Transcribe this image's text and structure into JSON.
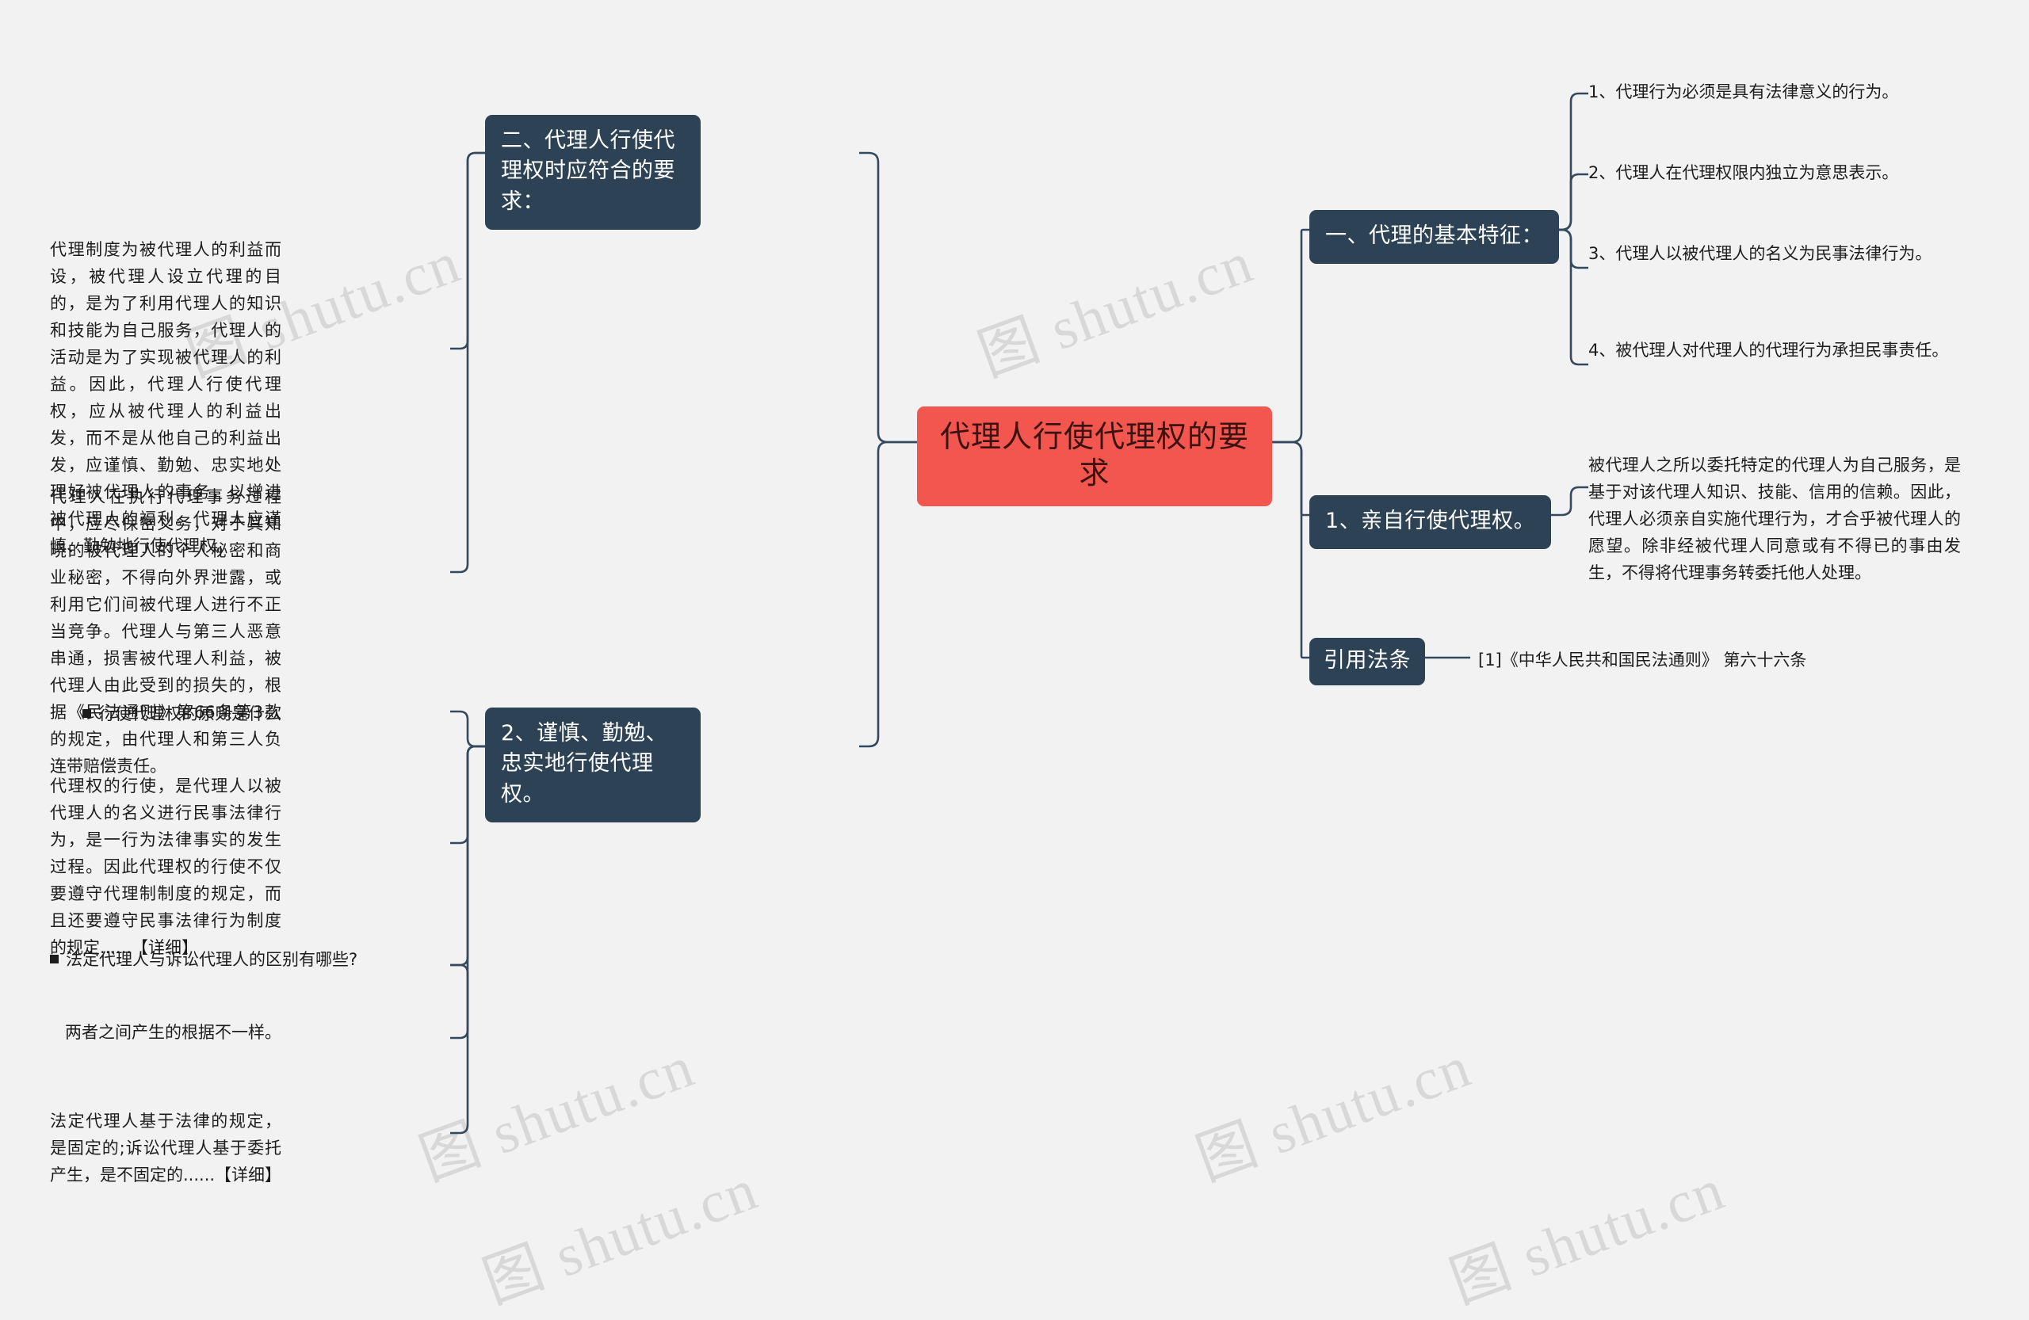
{
  "root": {
    "label": "代理人行使代理权的要求",
    "color": "#f2564f"
  },
  "theme": {
    "node_fill": "#2e4256",
    "node_text": "#ffffff",
    "link": "#34495e",
    "background": "#f2f2f2",
    "watermark": "shutu.cn"
  },
  "left_branch": {
    "heading": "二、代理人行使代理权时应符合的要求：",
    "paragraphs": [
      "代理制度为被代理人的利益而设，被代理人设立代理的目的，是为了利用代理人的知识和技能为自己服务，代理人的活动是为了实现被代理人的利益。因此，代理人行使代理权，应从被代理人的利益出发，而不是从他自己的利益出发，应谨慎、勤勉、忠实地处理好被代理人的事务，以增进被代理人的福利。代理人应谨慎、勤勉地行使代理权。",
      "代理人在执行代理事务过程中，应尽保密义务，对于其知晓的被代理人的个人秘密和商业秘密，不得向外界泄露，或利用它们间被代理人进行不正当竞争。代理人与第三人恶意串通，损害被代理人利益，被代理人由此受到的损失的，根据《民法通则》第66条第3款的规定，由代理人和第三人负连带赔偿责任。"
    ],
    "second_heading": "2、谨慎、勤勉、忠实地行使代理权。",
    "question_1": "行使代理权的原则是什么",
    "answer_1": "代理权的行使，是代理人以被代理人的名义进行民事法律行为，是一行为法律事实的发生过程。因此代理权的行使不仅要遵守代理制制度的规定，而且还要遵守民事法律行为制度的规定......【详细】",
    "question_2": "法定代理人与诉讼代理人的区别有哪些?",
    "answer_2_lead": "两者之间产生的根据不一样。",
    "answer_2": "法定代理人基于法律的规定，是固定的;诉讼代理人基于委托产生，是不固定的......【详细】"
  },
  "right_branch": {
    "heading": "一、代理的基本特征：",
    "features": [
      "1、代理行为必须是具有法律意义的行为。",
      "2、代理人在代理权限内独立为意思表示。",
      "3、代理人以被代理人的名义为民事法律行为。",
      "4、被代理人对代理人的代理行为承担民事责任。"
    ],
    "personal_heading": "1、亲自行使代理权。",
    "personal_body": "被代理人之所以委托特定的代理人为自己服务，是基于对该代理人知识、技能、信用的信赖。因此，代理人必须亲自实施代理行为，才合乎被代理人的愿望。除非经被代理人同意或有不得已的事由发生，不得将代理事务转委托他人处理。",
    "law_ref_heading": "引用法条",
    "law_ref_item": "[1]《中华人民共和国民法通则》 第六十六条"
  }
}
